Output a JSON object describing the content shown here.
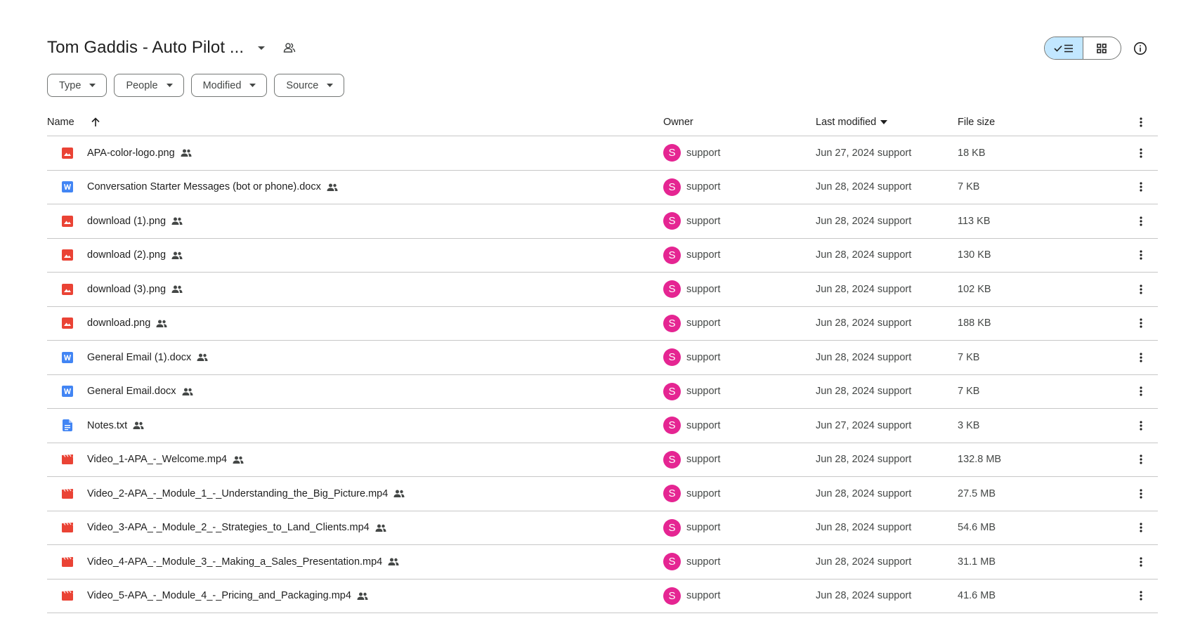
{
  "header": {
    "title": "Tom Gaddis - Auto Pilot ..."
  },
  "filters": [
    {
      "label": "Type"
    },
    {
      "label": "People"
    },
    {
      "label": "Modified"
    },
    {
      "label": "Source"
    }
  ],
  "columns": {
    "name": "Name",
    "owner": "Owner",
    "last_modified": "Last modified",
    "file_size": "File size"
  },
  "colors": {
    "accent_toggle": "#c2e7ff",
    "avatar": "#e52592",
    "image_icon": "#ea4335",
    "doc_icon": "#4285f4"
  },
  "files": [
    {
      "icon": "image-icon",
      "name": "APA-color-logo.png",
      "owner_initial": "S",
      "owner": "support",
      "modified": "Jun 27, 2024 support",
      "size": "18 KB"
    },
    {
      "icon": "word-icon",
      "name": "Conversation Starter Messages (bot or phone).docx",
      "owner_initial": "S",
      "owner": "support",
      "modified": "Jun 28, 2024 support",
      "size": "7 KB"
    },
    {
      "icon": "image-icon",
      "name": "download (1).png",
      "owner_initial": "S",
      "owner": "support",
      "modified": "Jun 28, 2024 support",
      "size": "113 KB"
    },
    {
      "icon": "image-icon",
      "name": "download (2).png",
      "owner_initial": "S",
      "owner": "support",
      "modified": "Jun 28, 2024 support",
      "size": "130 KB"
    },
    {
      "icon": "image-icon",
      "name": "download (3).png",
      "owner_initial": "S",
      "owner": "support",
      "modified": "Jun 28, 2024 support",
      "size": "102 KB"
    },
    {
      "icon": "image-icon",
      "name": "download.png",
      "owner_initial": "S",
      "owner": "support",
      "modified": "Jun 28, 2024 support",
      "size": "188 KB"
    },
    {
      "icon": "word-icon",
      "name": "General Email (1).docx",
      "owner_initial": "S",
      "owner": "support",
      "modified": "Jun 28, 2024 support",
      "size": "7 KB"
    },
    {
      "icon": "word-icon",
      "name": "General Email.docx",
      "owner_initial": "S",
      "owner": "support",
      "modified": "Jun 28, 2024 support",
      "size": "7 KB"
    },
    {
      "icon": "text-doc-icon",
      "name": "Notes.txt",
      "owner_initial": "S",
      "owner": "support",
      "modified": "Jun 27, 2024 support",
      "size": "3 KB"
    },
    {
      "icon": "video-icon",
      "name": "Video_1-APA_-_Welcome.mp4",
      "owner_initial": "S",
      "owner": "support",
      "modified": "Jun 28, 2024 support",
      "size": "132.8 MB"
    },
    {
      "icon": "video-icon",
      "name": "Video_2-APA_-_Module_1_-_Understanding_the_Big_Picture.mp4",
      "owner_initial": "S",
      "owner": "support",
      "modified": "Jun 28, 2024 support",
      "size": "27.5 MB"
    },
    {
      "icon": "video-icon",
      "name": "Video_3-APA_-_Module_2_-_Strategies_to_Land_Clients.mp4",
      "owner_initial": "S",
      "owner": "support",
      "modified": "Jun 28, 2024 support",
      "size": "54.6 MB"
    },
    {
      "icon": "video-icon",
      "name": "Video_4-APA_-_Module_3_-_Making_a_Sales_Presentation.mp4",
      "owner_initial": "S",
      "owner": "support",
      "modified": "Jun 28, 2024 support",
      "size": "31.1 MB"
    },
    {
      "icon": "video-icon",
      "name": "Video_5-APA_-_Module_4_-_Pricing_and_Packaging.mp4",
      "owner_initial": "S",
      "owner": "support",
      "modified": "Jun 28, 2024 support",
      "size": "41.6 MB"
    }
  ]
}
